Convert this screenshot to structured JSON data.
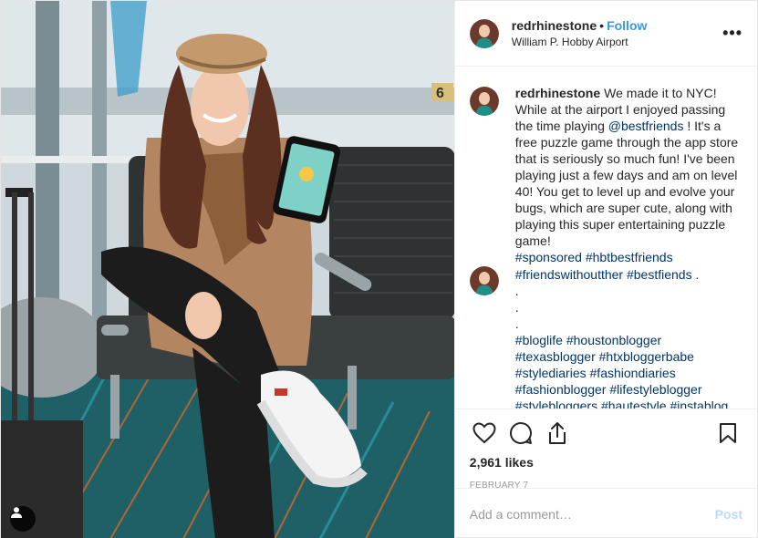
{
  "header": {
    "username": "redrhinestone",
    "separator": "•",
    "follow_label": "Follow",
    "location": "William P. Hobby Airport",
    "more_label": "•••"
  },
  "photo": {
    "gate_number": "6",
    "user_tag_icon": "user-silhouette-icon"
  },
  "caption": {
    "author": "redrhinestone",
    "text_1": "We made it to NYC! While at the airport I enjoyed passing the time playing",
    "mention": "@bestfriends",
    "text_2": "! It's a free puzzle game through the app store that is seriously so much fun! I've been playing just a few days and am on level 40! You get to level up and evolve your bugs, which are super cute, along with playing this super entertaining puzzle game!",
    "hashtags": [
      "#sponsored",
      "#hbtbestfriends"
    ]
  },
  "comment": {
    "hashtags_line1": [
      "#friendswithoutther",
      "#bestfiends"
    ],
    "trail": ".",
    "dots": [
      ".",
      ".",
      "."
    ],
    "hashtags_more": [
      [
        "#bloglife",
        "#houstonblogger"
      ],
      [
        "#texasblogger",
        "#htxbloggerbabe"
      ],
      [
        "#stylediaries",
        "#fashiondiaries"
      ],
      [
        "#fashionblogger",
        "#lifestyleblogger"
      ],
      [
        "#stylebloggers",
        "#hautestyle",
        "#instablog"
      ]
    ]
  },
  "actions": {
    "like_icon": "heart-icon",
    "comment_icon": "comment-icon",
    "share_icon": "share-icon",
    "save_icon": "bookmark-icon",
    "likes_text": "2,961 likes",
    "date": "February 7"
  },
  "add_comment": {
    "placeholder": "Add a comment…",
    "post_label": "Post"
  },
  "colors": {
    "link_blue": "#3897f0",
    "hashtag_blue": "#003569",
    "text": "#262626",
    "muted": "#999999"
  }
}
